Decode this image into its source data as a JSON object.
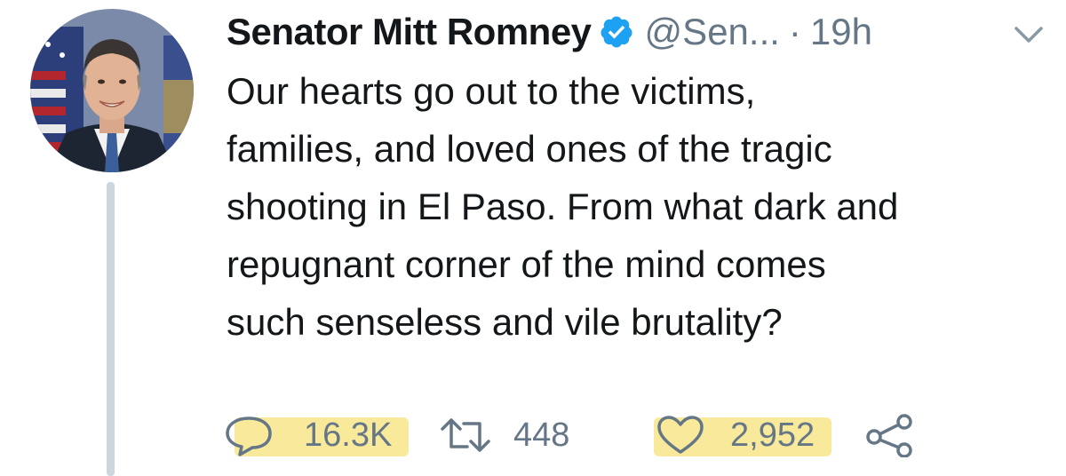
{
  "tweet": {
    "display_name": "Senator Mitt Romney",
    "handle": "@Sen...",
    "separator": "·",
    "timestamp": "19h",
    "text": "Our hearts go out to the victims,\nfamilies, and loved ones of the tragic\nshooting in El Paso. From what dark and\nrepugnant corner of the mind comes\nsuch senseless and vile brutality?",
    "verified": true
  },
  "actions": {
    "replies": "16.3K",
    "retweets": "448",
    "likes": "2,952"
  },
  "icons": {
    "verified": "verified-badge-icon",
    "menu": "chevron-down-icon",
    "reply": "reply-bubble-icon",
    "retweet": "retweet-icon",
    "like": "heart-icon",
    "share": "share-icon"
  },
  "colors": {
    "verified_blue": "#1da1f2",
    "secondary_text": "#657786",
    "primary_text": "#14171a",
    "highlight": "#f6e27a"
  }
}
